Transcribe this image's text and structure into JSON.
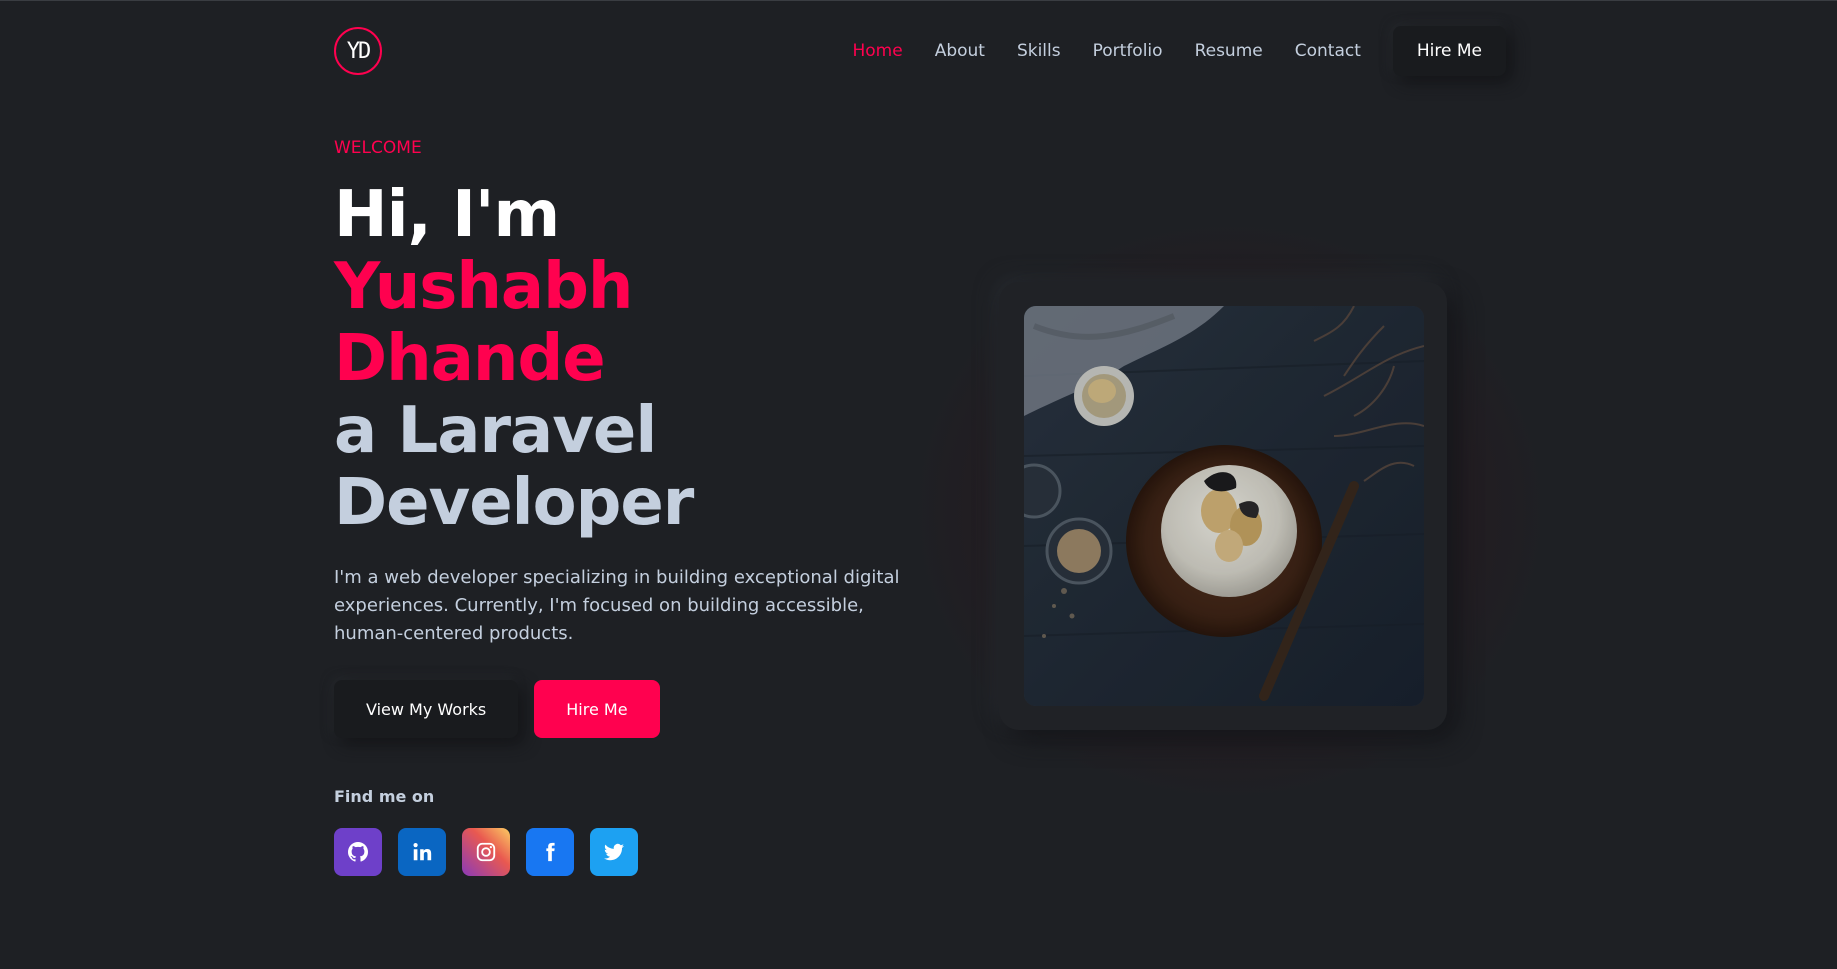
{
  "header": {
    "logo_text": "YD",
    "nav": [
      {
        "label": "Home",
        "active": true
      },
      {
        "label": "About"
      },
      {
        "label": "Skills"
      },
      {
        "label": "Portfolio"
      },
      {
        "label": "Resume"
      },
      {
        "label": "Contact"
      }
    ],
    "hire_label": "Hire Me"
  },
  "hero": {
    "welcome": "WELCOME",
    "line1": "Hi, I'm",
    "name1": "Yushabh",
    "name2": "Dhande",
    "role1": "a Laravel",
    "role2": "Developer",
    "description": "I'm a web developer specializing in building exceptional digital experiences. Currently, I'm focused on building accessible, human-centered products.",
    "btn_works": "View My Works",
    "btn_hire": "Hire Me",
    "find_me": "Find me on"
  },
  "socials": [
    {
      "icon": "github-icon"
    },
    {
      "icon": "linkedin-icon"
    },
    {
      "icon": "instagram-icon"
    },
    {
      "icon": "facebook-icon"
    },
    {
      "icon": "twitter-icon"
    }
  ],
  "colors": {
    "accent": "#ff014f",
    "background": "#1e2024",
    "text": "#c4cfde"
  }
}
